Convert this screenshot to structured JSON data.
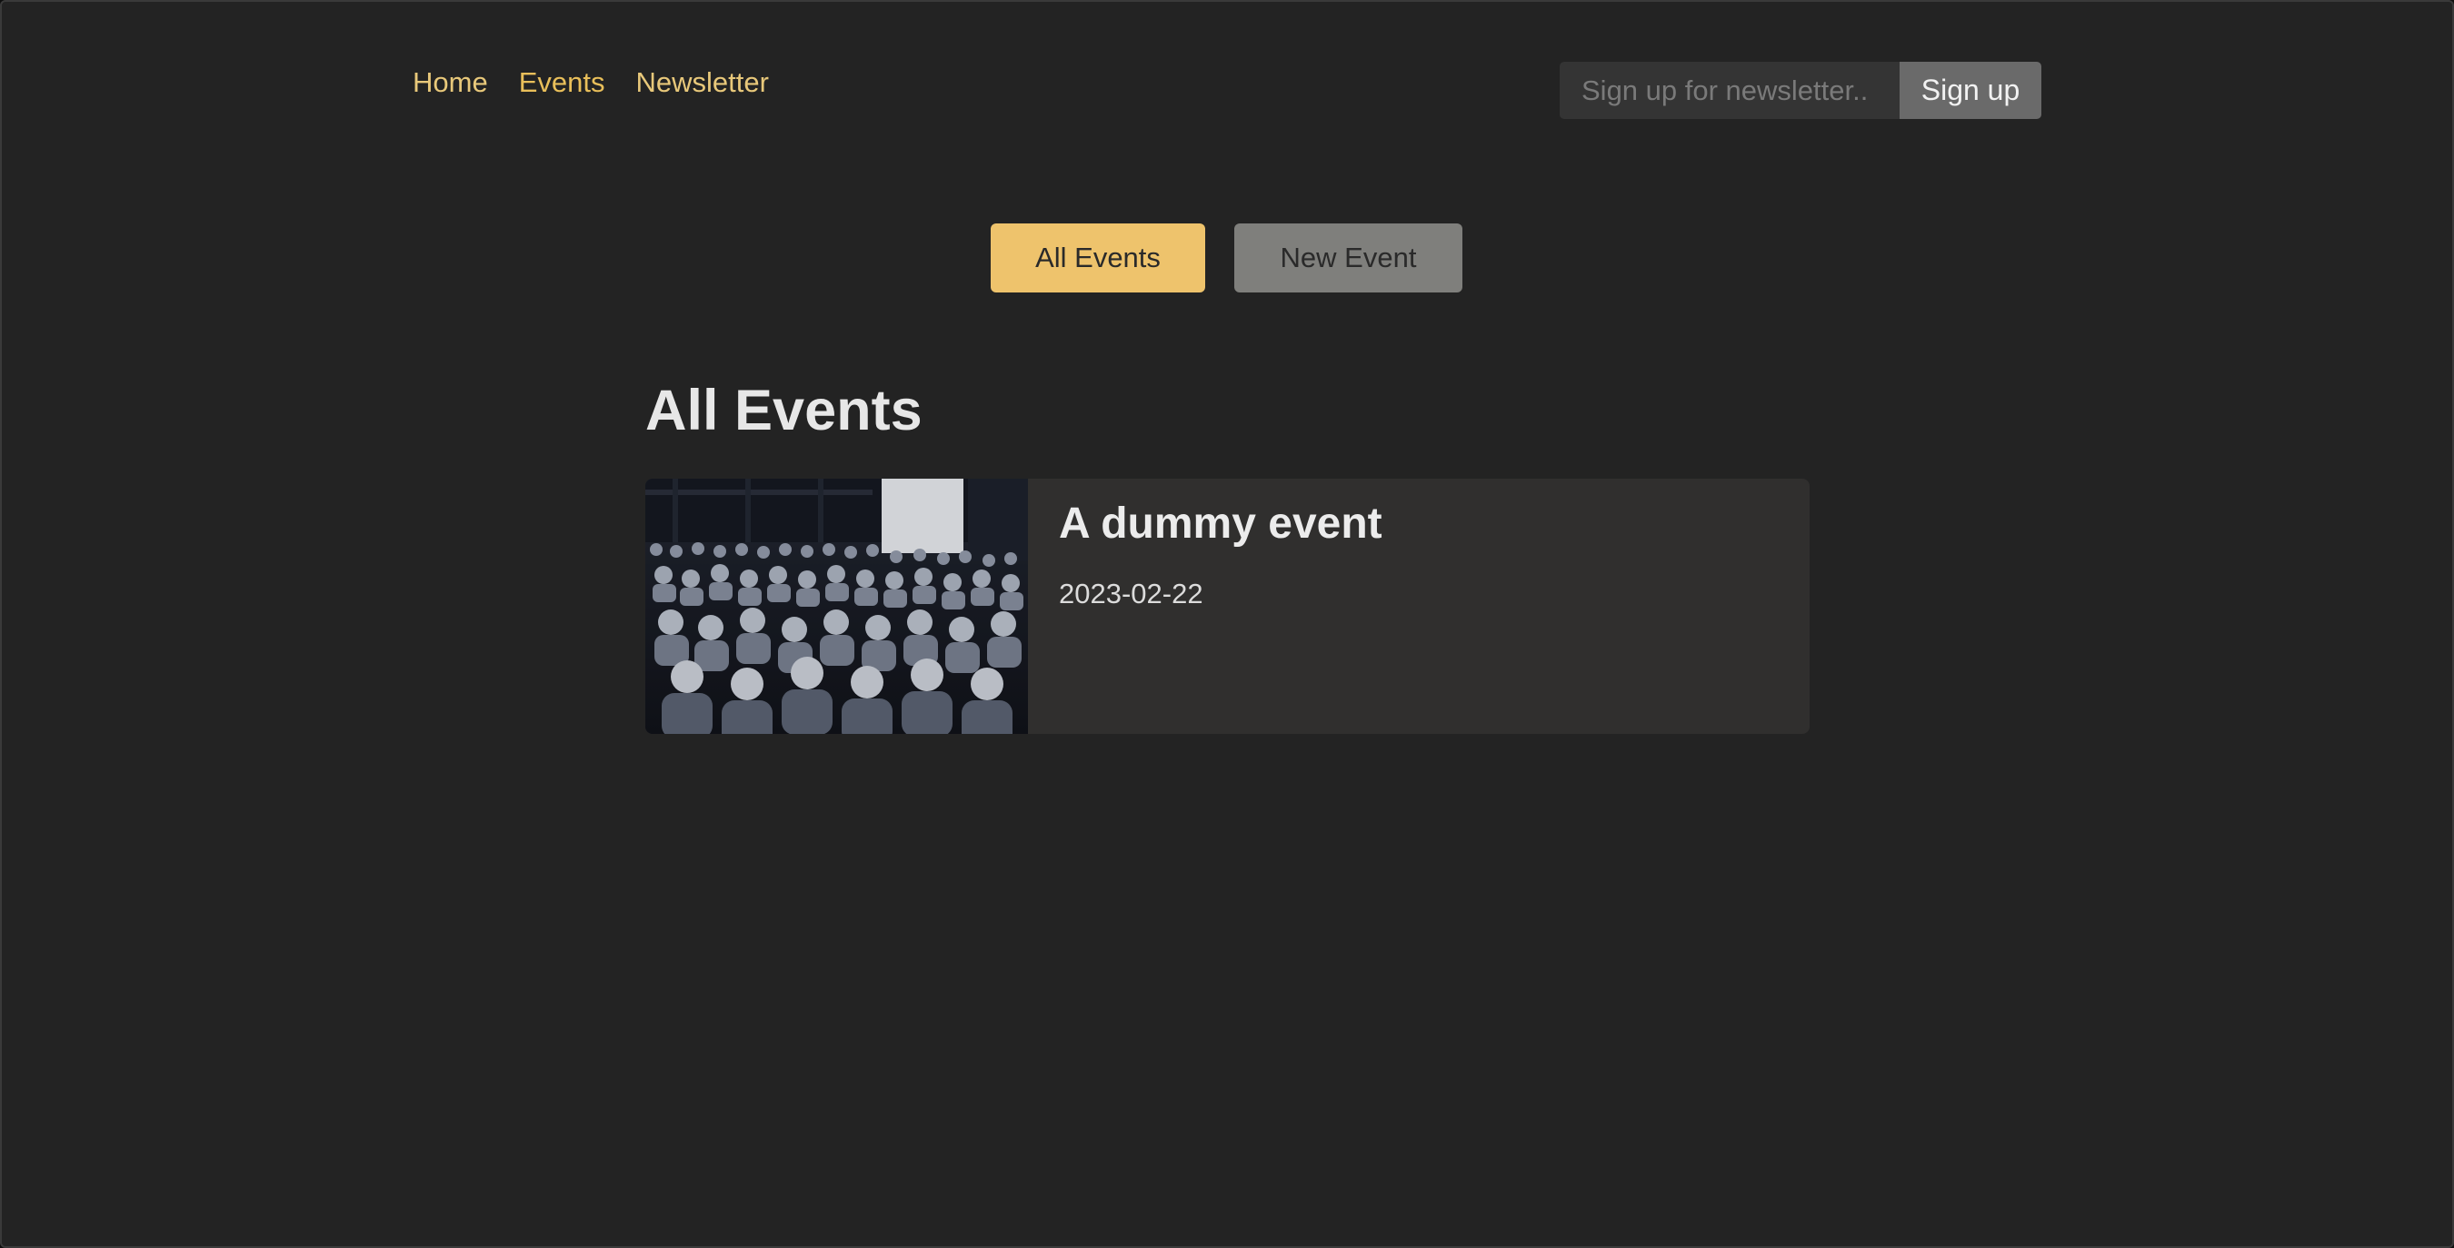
{
  "colors": {
    "background": "#232323",
    "accent": "#e9bf5a",
    "nav_link": "#e8c87a",
    "primary_button": "#eec36c",
    "secondary_button": "#7f7f7c",
    "card_background": "#302f2e"
  },
  "nav": {
    "items": [
      {
        "label": "Home"
      },
      {
        "label": "Events"
      },
      {
        "label": "Newsletter"
      }
    ],
    "active": "Events"
  },
  "newsletter": {
    "placeholder": "Sign up for newsletter..",
    "value": "",
    "button_label": "Sign up"
  },
  "actions": {
    "all_events_label": "All Events",
    "new_event_label": "New Event"
  },
  "main": {
    "title": "All Events",
    "events": [
      {
        "title": "A dummy event",
        "date": "2023-02-22",
        "image": "audience-photo"
      }
    ]
  }
}
